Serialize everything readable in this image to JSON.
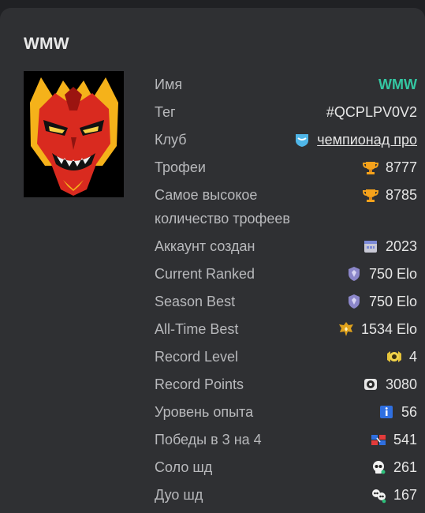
{
  "card": {
    "title": "WMW"
  },
  "profile": {
    "avatar_icon": "red-devil-avatar-icon",
    "rows": [
      {
        "label": "Имя",
        "value": "WMW",
        "icon": null,
        "accent": "#34c7a2"
      },
      {
        "label": "Тег",
        "value": "#QCPLPV0V2",
        "icon": null
      },
      {
        "label": "Клуб",
        "value": "чемпионад про",
        "icon": "club-badge-icon"
      },
      {
        "label": "Трофеи",
        "value": "8777",
        "icon": "trophy-icon"
      },
      {
        "label": "Самое высокое количество трофеев",
        "value": "8785",
        "icon": "trophy-icon"
      },
      {
        "label": "Аккаунт создан",
        "value": "2023",
        "icon": "calendar-icon"
      },
      {
        "label": "Current Ranked",
        "value": "750 Elo",
        "icon": "ranked-shield-icon"
      },
      {
        "label": "Season Best",
        "value": "750 Elo",
        "icon": "ranked-shield-icon"
      },
      {
        "label": "All-Time Best",
        "value": "1534 Elo",
        "icon": "gold-rank-icon"
      },
      {
        "label": "Record Level",
        "value": "4",
        "icon": "record-level-icon"
      },
      {
        "label": "Record Points",
        "value": "3080",
        "icon": "record-points-icon"
      },
      {
        "label": "Уровень опыта",
        "value": "56",
        "icon": "info-badge-icon"
      },
      {
        "label": "Победы в 3 на 4",
        "value": "541",
        "icon": "team-versus-icon"
      },
      {
        "label": "Соло шд",
        "value": "261",
        "icon": "skull-icon"
      },
      {
        "label": "Дуо шд",
        "value": "167",
        "icon": "duo-skull-icon"
      }
    ]
  },
  "colors": {
    "accent": "#34c7a2",
    "card_background": "#2f3033",
    "page_background": "#202124"
  }
}
